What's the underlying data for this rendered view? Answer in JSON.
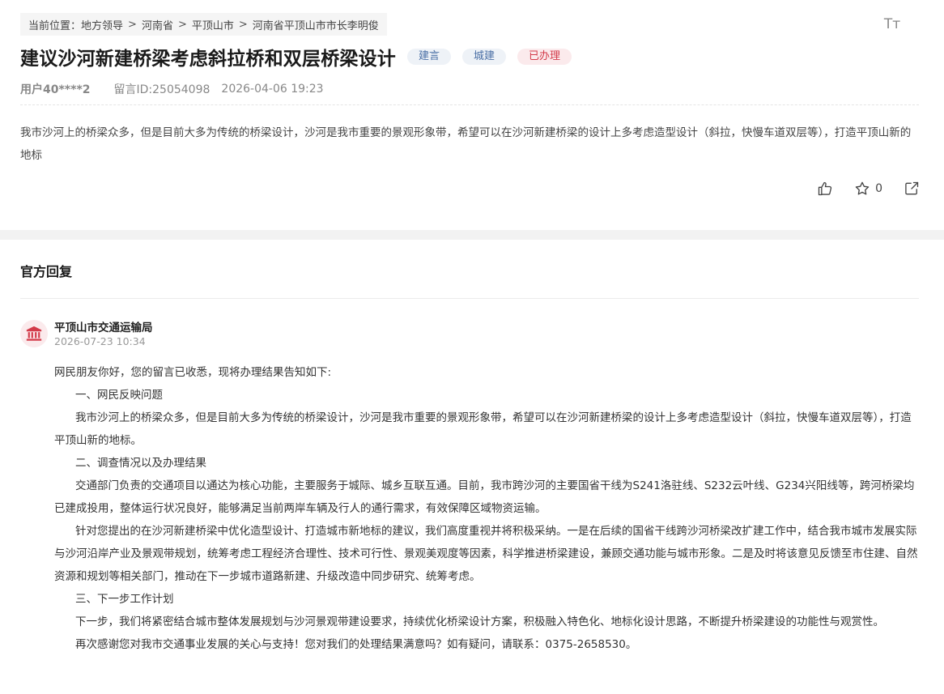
{
  "breadcrumb": {
    "prefix": "当前位置：",
    "items": [
      "地方领导",
      "河南省",
      "平顶山市",
      "河南省平顶山市市长李明俊"
    ],
    "separator": ">"
  },
  "font_size_icon": "Tт",
  "message": {
    "title": "建议沙河新建桥梁考虑斜拉桥和双层桥梁设计",
    "tags": [
      "建言",
      "城建",
      "已办理"
    ],
    "user": "用户40****2",
    "message_id": "留言ID:25054098",
    "datetime": "2026-04-06 19:23",
    "content": "我市沙河上的桥梁众多，但是目前大多为传统的桥梁设计，沙河是我市重要的景观形象带，希望可以在沙河新建桥梁的设计上多考虑造型设计（斜拉，快慢车道双层等），打造平顶山新的地标",
    "favorite_count": "0"
  },
  "reply": {
    "section_title": "官方回复",
    "org_name": "平顶山市交通运输局",
    "org_time": "2026-07-23 10:34",
    "paragraphs": [
      "网民朋友你好，您的留言已收悉，现将办理结果告知如下:",
      "一、网民反映问题",
      " 我市沙河上的桥梁众多，但是目前大多为传统的桥梁设计，沙河是我市重要的景观形象带，希望可以在沙河新建桥梁的设计上多考虑造型设计（斜拉，快慢车道双层等），打造平顶山新的地标。",
      "二、调查情况以及办理结果",
      "交通部门负责的交通项目以通达为核心功能，主要服务于城际、城乡互联互通。目前，我市跨沙河的主要国省干线为S241洛驻线、S232云叶线、G234兴阳线等，跨河桥梁均已建成投用，整体运行状况良好，能够满足当前两岸车辆及行人的通行需求，有效保障区域物资运输。",
      "针对您提出的在沙河新建桥梁中优化造型设计、打造城市新地标的建议，我们高度重视并将积极采纳。一是在后续的国省干线跨沙河桥梁改扩建工作中，结合我市城市发展实际与沙河沿岸产业及景观带规划，统筹考虑工程经济合理性、技术可行性、景观美观度等因素，科学推进桥梁建设，兼顾交通功能与城市形象。二是及时将该意见反馈至市住建、自然资源和规划等相关部门，推动在下一步城市道路新建、升级改造中同步研究、统筹考虑。",
      "三、下一步工作计划",
      "下一步，我们将紧密结合城市整体发展规划与沙河景观带建设要求，持续优化桥梁设计方案，积极融入特色化、地标化设计思路，不断提升桥梁建设的功能性与观赏性。",
      "再次感谢您对我市交通事业发展的关心与支持！您对我们的处理结果满意吗？如有疑问，请联系：0375-2658530。"
    ]
  },
  "colors": {
    "tag_blue_bg": "#eef2f7",
    "tag_blue_text": "#4a6fa5",
    "tag_red_bg": "#fbeaec",
    "tag_red_text": "#d33b4a",
    "org_icon": "#d33b4a"
  },
  "icons": [
    "thumbs-up-icon",
    "star-icon",
    "share-icon",
    "government-building-icon",
    "font-size-icon"
  ]
}
